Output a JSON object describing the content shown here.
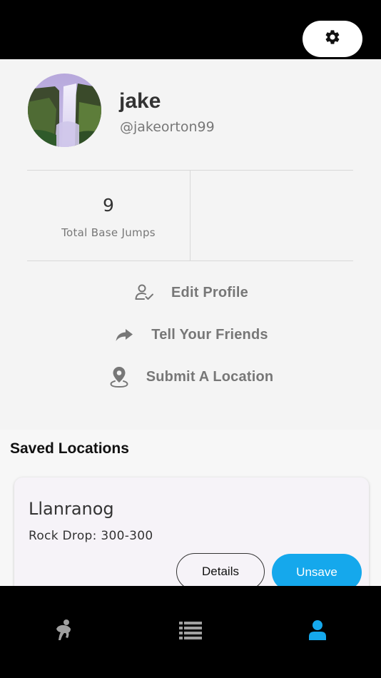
{
  "topbar": {
    "settings_icon": "gear-icon"
  },
  "profile": {
    "name": "jake",
    "handle": "@jakeorton99",
    "avatar": "waterfall-photo"
  },
  "stats": [
    {
      "value": "9",
      "label": "Total Base Jumps"
    }
  ],
  "actions": [
    {
      "label": "Edit Profile",
      "icon": "user-check-icon"
    },
    {
      "label": "Tell Your Friends",
      "icon": "share-arrow-icon"
    },
    {
      "label": "Submit A Location",
      "icon": "map-pin-icon"
    }
  ],
  "saved": {
    "title": "Saved Locations",
    "items": [
      {
        "name": "Llanranog",
        "detail": "Rock Drop: 300-300",
        "details_label": "Details",
        "unsave_label": "Unsave"
      }
    ]
  },
  "tabbar": {
    "tabs": [
      {
        "icon": "jumper-icon",
        "active": false
      },
      {
        "icon": "list-icon",
        "active": false
      },
      {
        "icon": "person-icon",
        "active": true
      }
    ]
  },
  "colors": {
    "accent": "#15a8ec",
    "tab_inactive": "#a0a0a0",
    "text_muted": "#777777"
  }
}
